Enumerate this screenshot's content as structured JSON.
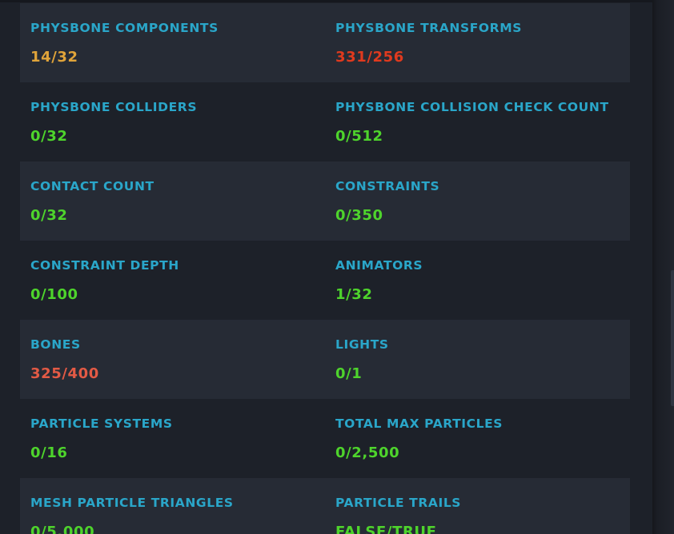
{
  "colors": {
    "label": "#2aa6c9",
    "ok": "#4ed42c",
    "warn": "#e0a43a",
    "bad": "#e03a1e",
    "over": "#e35a45",
    "row_shaded": "#262b35",
    "background": "#1d2129"
  },
  "stats": {
    "physbone_components": {
      "label": "PHYSBONE COMPONENTS",
      "value": "14/32",
      "status": "warn"
    },
    "physbone_transforms": {
      "label": "PHYSBONE TRANSFORMS",
      "value": "331/256",
      "status": "bad"
    },
    "physbone_colliders": {
      "label": "PHYSBONE COLLIDERS",
      "value": "0/32",
      "status": "ok"
    },
    "physbone_collision_check_count": {
      "label": "PHYSBONE COLLISION CHECK COUNT",
      "value": "0/512",
      "status": "ok"
    },
    "contact_count": {
      "label": "CONTACT COUNT",
      "value": "0/32",
      "status": "ok"
    },
    "constraints": {
      "label": "CONSTRAINTS",
      "value": "0/350",
      "status": "ok"
    },
    "constraint_depth": {
      "label": "CONSTRAINT DEPTH",
      "value": "0/100",
      "status": "ok"
    },
    "animators": {
      "label": "ANIMATORS",
      "value": "1/32",
      "status": "ok"
    },
    "bones": {
      "label": "BONES",
      "value": "325/400",
      "status": "over"
    },
    "lights": {
      "label": "LIGHTS",
      "value": "0/1",
      "status": "ok"
    },
    "particle_systems": {
      "label": "PARTICLE SYSTEMS",
      "value": "0/16",
      "status": "ok"
    },
    "total_max_particles": {
      "label": "TOTAL MAX PARTICLES",
      "value": "0/2,500",
      "status": "ok"
    },
    "mesh_particle_triangles": {
      "label": "MESH PARTICLE TRIANGLES",
      "value": "0/5,000",
      "status": "ok"
    },
    "particle_trails": {
      "label": "PARTICLE TRAILS",
      "value": "FALSE/TRUE",
      "status": "ok"
    }
  }
}
